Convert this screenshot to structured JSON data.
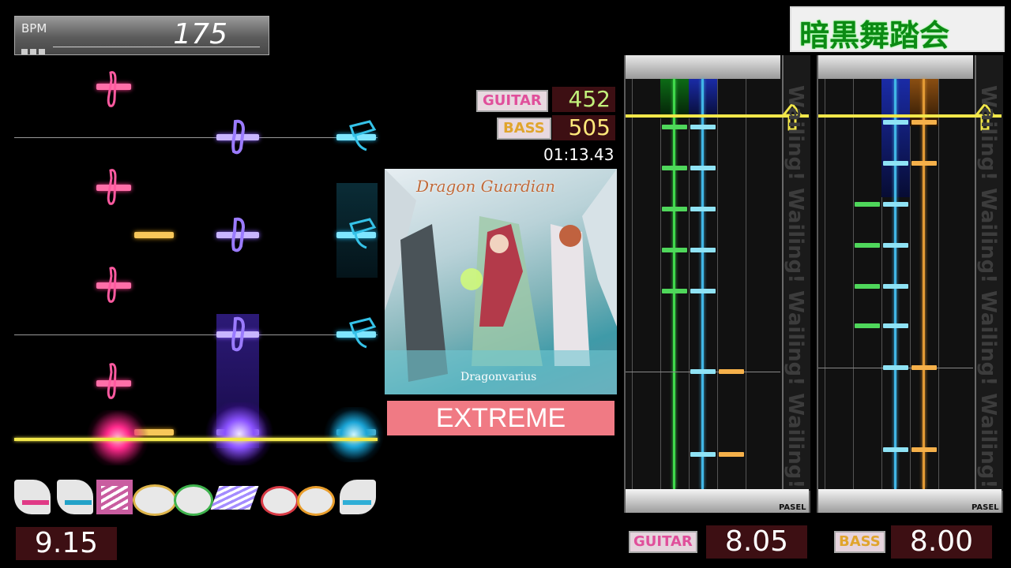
{
  "header": {
    "title": "暗黒舞踏会"
  },
  "bpm": {
    "label": "BPM",
    "value": "175"
  },
  "drums": {
    "score": "9.15"
  },
  "scores": {
    "guitar": {
      "label": "GUITAR",
      "value": "452"
    },
    "bass": {
      "label": "BASS",
      "value": "505"
    },
    "time": "01:13.43"
  },
  "album": {
    "title_art": "Dragon Guardian",
    "artist_art": "Dragonvarius",
    "difficulty": "EXTREME"
  },
  "guitar_panel": {
    "label": "GUITAR",
    "skill": "8.05",
    "overlay_text": "Wailing! Wailing! Wailing! Wailing!",
    "pasel": "PASEL"
  },
  "bass_panel": {
    "label": "BASS",
    "skill": "8.00",
    "overlay_text": "Wailing! Wailing! Wailing! Wailing!",
    "pasel": "PASEL"
  },
  "colors": {
    "accent_pink": "#ff6fa8",
    "difficulty_bg": "#f07a84",
    "judge_line": "#f2e74a",
    "green": "#4fd75b",
    "blue": "#2a3fbf",
    "orange": "#e39a34"
  }
}
